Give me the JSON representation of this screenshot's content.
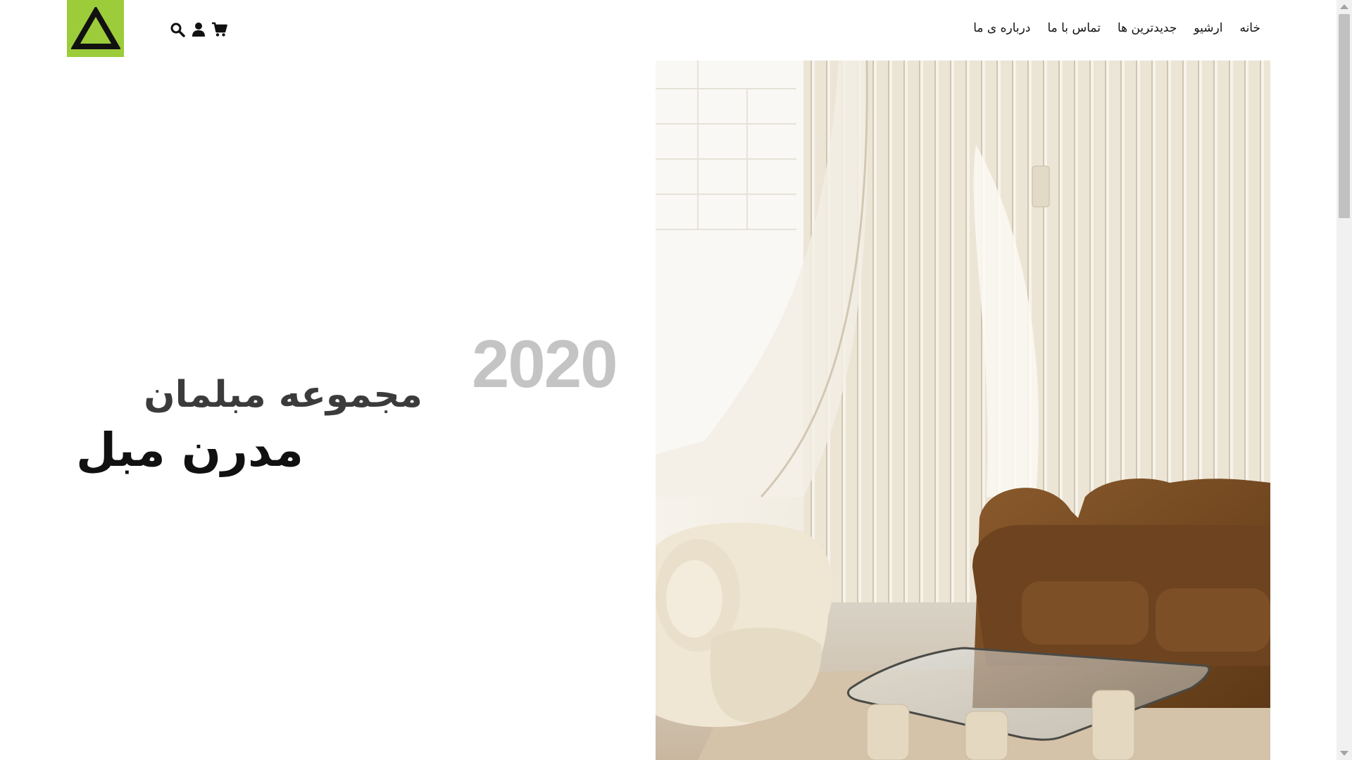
{
  "brand": {
    "logo_icon": "triangle-logo-icon",
    "accent": "#9ccc3a"
  },
  "header_icons": [
    "search-icon",
    "user-icon",
    "cart-icon"
  ],
  "nav": {
    "items": [
      {
        "label": "خانه"
      },
      {
        "label": "ارشیو"
      },
      {
        "label": "جدیدترین ها"
      },
      {
        "label": "تماس با ما"
      },
      {
        "label": "درباره ی ما"
      }
    ]
  },
  "hero": {
    "year": "2020",
    "collection": "مجموعه مبلمان",
    "product": "مدرن مبل",
    "image_icon": "living-room-photo"
  }
}
